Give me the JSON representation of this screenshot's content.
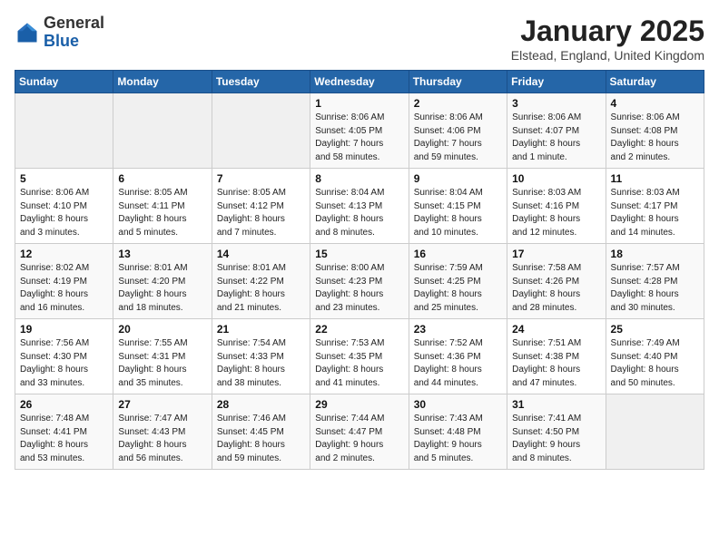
{
  "header": {
    "logo_general": "General",
    "logo_blue": "Blue",
    "month_title": "January 2025",
    "location": "Elstead, England, United Kingdom"
  },
  "weekdays": [
    "Sunday",
    "Monday",
    "Tuesday",
    "Wednesday",
    "Thursday",
    "Friday",
    "Saturday"
  ],
  "weeks": [
    [
      {
        "day": "",
        "info": ""
      },
      {
        "day": "",
        "info": ""
      },
      {
        "day": "",
        "info": ""
      },
      {
        "day": "1",
        "info": "Sunrise: 8:06 AM\nSunset: 4:05 PM\nDaylight: 7 hours\nand 58 minutes."
      },
      {
        "day": "2",
        "info": "Sunrise: 8:06 AM\nSunset: 4:06 PM\nDaylight: 7 hours\nand 59 minutes."
      },
      {
        "day": "3",
        "info": "Sunrise: 8:06 AM\nSunset: 4:07 PM\nDaylight: 8 hours\nand 1 minute."
      },
      {
        "day": "4",
        "info": "Sunrise: 8:06 AM\nSunset: 4:08 PM\nDaylight: 8 hours\nand 2 minutes."
      }
    ],
    [
      {
        "day": "5",
        "info": "Sunrise: 8:06 AM\nSunset: 4:10 PM\nDaylight: 8 hours\nand 3 minutes."
      },
      {
        "day": "6",
        "info": "Sunrise: 8:05 AM\nSunset: 4:11 PM\nDaylight: 8 hours\nand 5 minutes."
      },
      {
        "day": "7",
        "info": "Sunrise: 8:05 AM\nSunset: 4:12 PM\nDaylight: 8 hours\nand 7 minutes."
      },
      {
        "day": "8",
        "info": "Sunrise: 8:04 AM\nSunset: 4:13 PM\nDaylight: 8 hours\nand 8 minutes."
      },
      {
        "day": "9",
        "info": "Sunrise: 8:04 AM\nSunset: 4:15 PM\nDaylight: 8 hours\nand 10 minutes."
      },
      {
        "day": "10",
        "info": "Sunrise: 8:03 AM\nSunset: 4:16 PM\nDaylight: 8 hours\nand 12 minutes."
      },
      {
        "day": "11",
        "info": "Sunrise: 8:03 AM\nSunset: 4:17 PM\nDaylight: 8 hours\nand 14 minutes."
      }
    ],
    [
      {
        "day": "12",
        "info": "Sunrise: 8:02 AM\nSunset: 4:19 PM\nDaylight: 8 hours\nand 16 minutes."
      },
      {
        "day": "13",
        "info": "Sunrise: 8:01 AM\nSunset: 4:20 PM\nDaylight: 8 hours\nand 18 minutes."
      },
      {
        "day": "14",
        "info": "Sunrise: 8:01 AM\nSunset: 4:22 PM\nDaylight: 8 hours\nand 21 minutes."
      },
      {
        "day": "15",
        "info": "Sunrise: 8:00 AM\nSunset: 4:23 PM\nDaylight: 8 hours\nand 23 minutes."
      },
      {
        "day": "16",
        "info": "Sunrise: 7:59 AM\nSunset: 4:25 PM\nDaylight: 8 hours\nand 25 minutes."
      },
      {
        "day": "17",
        "info": "Sunrise: 7:58 AM\nSunset: 4:26 PM\nDaylight: 8 hours\nand 28 minutes."
      },
      {
        "day": "18",
        "info": "Sunrise: 7:57 AM\nSunset: 4:28 PM\nDaylight: 8 hours\nand 30 minutes."
      }
    ],
    [
      {
        "day": "19",
        "info": "Sunrise: 7:56 AM\nSunset: 4:30 PM\nDaylight: 8 hours\nand 33 minutes."
      },
      {
        "day": "20",
        "info": "Sunrise: 7:55 AM\nSunset: 4:31 PM\nDaylight: 8 hours\nand 35 minutes."
      },
      {
        "day": "21",
        "info": "Sunrise: 7:54 AM\nSunset: 4:33 PM\nDaylight: 8 hours\nand 38 minutes."
      },
      {
        "day": "22",
        "info": "Sunrise: 7:53 AM\nSunset: 4:35 PM\nDaylight: 8 hours\nand 41 minutes."
      },
      {
        "day": "23",
        "info": "Sunrise: 7:52 AM\nSunset: 4:36 PM\nDaylight: 8 hours\nand 44 minutes."
      },
      {
        "day": "24",
        "info": "Sunrise: 7:51 AM\nSunset: 4:38 PM\nDaylight: 8 hours\nand 47 minutes."
      },
      {
        "day": "25",
        "info": "Sunrise: 7:49 AM\nSunset: 4:40 PM\nDaylight: 8 hours\nand 50 minutes."
      }
    ],
    [
      {
        "day": "26",
        "info": "Sunrise: 7:48 AM\nSunset: 4:41 PM\nDaylight: 8 hours\nand 53 minutes."
      },
      {
        "day": "27",
        "info": "Sunrise: 7:47 AM\nSunset: 4:43 PM\nDaylight: 8 hours\nand 56 minutes."
      },
      {
        "day": "28",
        "info": "Sunrise: 7:46 AM\nSunset: 4:45 PM\nDaylight: 8 hours\nand 59 minutes."
      },
      {
        "day": "29",
        "info": "Sunrise: 7:44 AM\nSunset: 4:47 PM\nDaylight: 9 hours\nand 2 minutes."
      },
      {
        "day": "30",
        "info": "Sunrise: 7:43 AM\nSunset: 4:48 PM\nDaylight: 9 hours\nand 5 minutes."
      },
      {
        "day": "31",
        "info": "Sunrise: 7:41 AM\nSunset: 4:50 PM\nDaylight: 9 hours\nand 8 minutes."
      },
      {
        "day": "",
        "info": ""
      }
    ]
  ]
}
